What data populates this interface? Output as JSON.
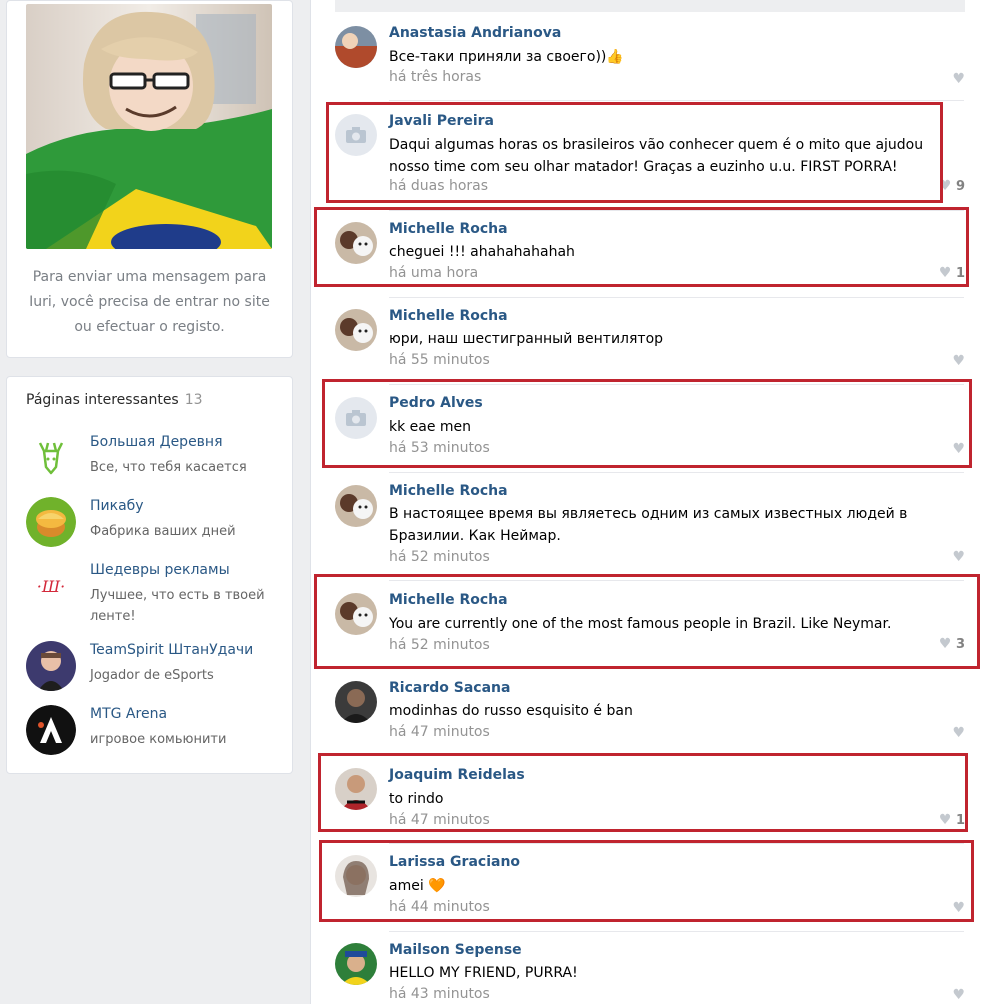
{
  "profile": {
    "message_note": "Para enviar uma mensagem para\nIuri, você precisa de entrar no site\nou efectuar o registo."
  },
  "interesting_pages": {
    "title": "Páginas interessantes",
    "count": "13",
    "items": [
      {
        "name": "Большая Деревня",
        "desc": "Все, что тебя касается",
        "icon": "deer-icon"
      },
      {
        "name": "Пикабу",
        "desc": "Фабрика ваших дней",
        "icon": "pikabu-logo"
      },
      {
        "name": "Шедевры рекламы",
        "desc": "Лучшее, что есть в твоей ленте!",
        "icon": "shedevry-logo"
      },
      {
        "name": "TeamSpirit ШтанУдачи",
        "desc": "Jogador de eSports",
        "icon": "player-avatar"
      },
      {
        "name": "MTG Arena",
        "desc": "игровое комьюнити",
        "icon": "mtg-arena-logo"
      }
    ]
  },
  "comments": [
    {
      "author": "Anastasia Andrianova",
      "text": "Все-таки приняли за своего))👍",
      "time": "há três horas",
      "likes": ""
    },
    {
      "author": "Javali Pereira",
      "text": "Daqui algumas horas os brasileiros vão conhecer quem é o mito que ajudou nosso time com seu olhar matador! Graças a euzinho u.u. FIRST PORRA!",
      "time": "há duas horas",
      "likes": "9"
    },
    {
      "author": "Michelle Rocha",
      "text": "cheguei !!! ahahahahahah",
      "time": "há uma hora",
      "likes": "1"
    },
    {
      "author": "Michelle Rocha",
      "text": "юри, наш шестигранный вентилятор",
      "time": "há 55 minutos",
      "likes": ""
    },
    {
      "author": "Pedro Alves",
      "text": "kk eae men",
      "time": "há 53 minutos",
      "likes": ""
    },
    {
      "author": "Michelle Rocha",
      "text": "В настоящее время вы являетесь одним из самых известных людей в Бразилии. Как Неймар.",
      "time": "há 52 minutos",
      "likes": ""
    },
    {
      "author": "Michelle Rocha",
      "text": "You are currently one of the most famous people in Brazil. Like Neymar.",
      "time": "há 52 minutos",
      "likes": "3"
    },
    {
      "author": "Ricardo Sacana",
      "text": "modinhas do russo esquisito é ban",
      "time": "há 47 minutos",
      "likes": ""
    },
    {
      "author": "Joaquim Reidelas",
      "text": "to rindo",
      "time": "há 47 minutos",
      "likes": "1"
    },
    {
      "author": "Larissa Graciano",
      "text": "amei 🧡",
      "time": "há 44 minutos",
      "likes": ""
    },
    {
      "author": "Mailson Sepense",
      "text": "HELLO MY FRIEND, PURRA!",
      "time": "há 43 minutos",
      "likes": ""
    }
  ],
  "colors": {
    "link_blue": "#2a5885",
    "highlight_red": "#c0242f",
    "background": "#edeef0"
  }
}
